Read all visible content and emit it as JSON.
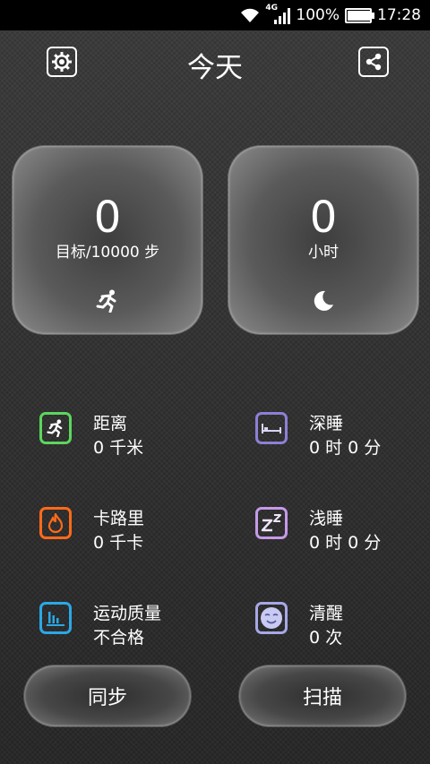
{
  "status_bar": {
    "network": "4G",
    "battery_text": "100%",
    "battery_level": 1.0,
    "time": "17:28"
  },
  "header": {
    "title": "今天",
    "settings_icon": "gear-icon",
    "share_icon": "share-icon"
  },
  "cards": {
    "steps": {
      "value": "0",
      "goal": "目标/10000 步",
      "icon": "running-icon"
    },
    "sleep": {
      "value": "0",
      "unit": "小时",
      "icon": "moon-icon"
    }
  },
  "stats": {
    "distance": {
      "label": "距离",
      "value": "0 千米",
      "color": "#5cd65c",
      "icon": "running-icon"
    },
    "deep_sleep": {
      "label": "深睡",
      "value": "0 时 0 分",
      "color": "#8f7fd6",
      "icon": "bed-icon"
    },
    "calories": {
      "label": "卡路里",
      "value": "0 千卡",
      "color": "#ff6a1a",
      "icon": "flame-icon"
    },
    "light_sleep": {
      "label": "浅睡",
      "value": "0 时 0 分",
      "color": "#c59ae8",
      "icon": "zz-icon"
    },
    "quality": {
      "label": "运动质量",
      "value": "不合格",
      "color": "#2aa8e6",
      "icon": "bar-chart-icon"
    },
    "awake": {
      "label": "清醒",
      "value": "0 次",
      "color": "#a6a8e6",
      "icon": "smiley-icon"
    }
  },
  "buttons": {
    "sync": "同步",
    "scan": "扫描"
  }
}
